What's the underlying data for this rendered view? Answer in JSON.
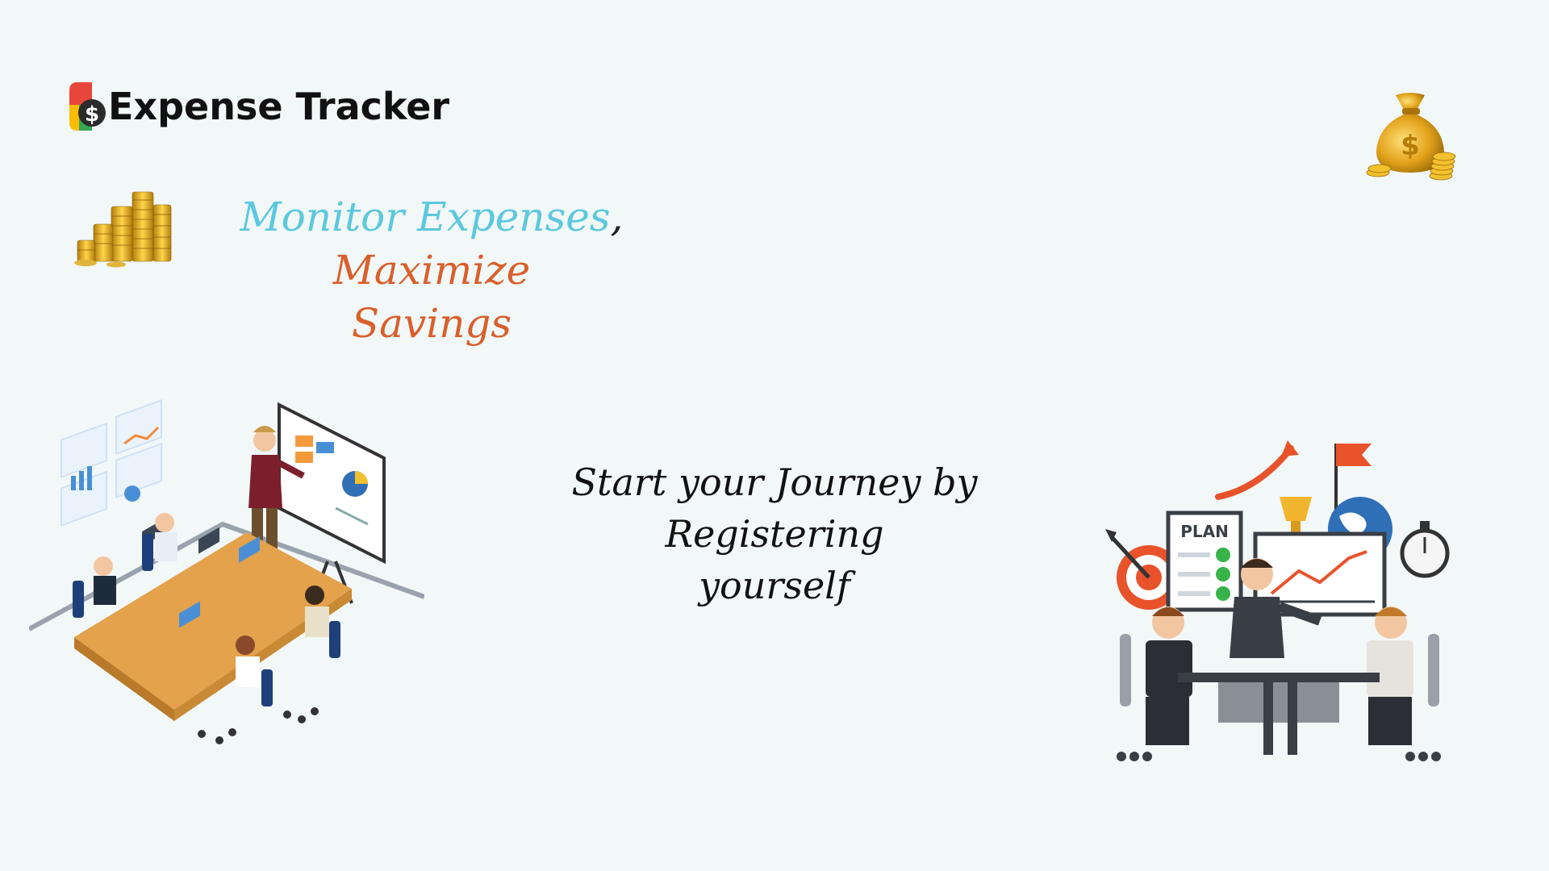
{
  "brand": {
    "name": "Expense Tracker",
    "logo_icon": "dollar-coin-logo-icon"
  },
  "tagline": {
    "part1": "Monitor Expenses",
    "separator": ",",
    "part2_line1": "Maximize",
    "part2_line2": "Savings"
  },
  "journey": {
    "line1": "Start your Journey by Registering",
    "line2": "yourself"
  },
  "plan_board": {
    "label": "PLAN"
  },
  "icons": {
    "coins": "gold-coins-stack-icon",
    "money_bag": "money-bag-icon"
  },
  "colors": {
    "background": "#f2f7f8",
    "tagline_blue": "#5bc8df",
    "tagline_orange": "#d95f2b",
    "text_dark": "#111111"
  }
}
